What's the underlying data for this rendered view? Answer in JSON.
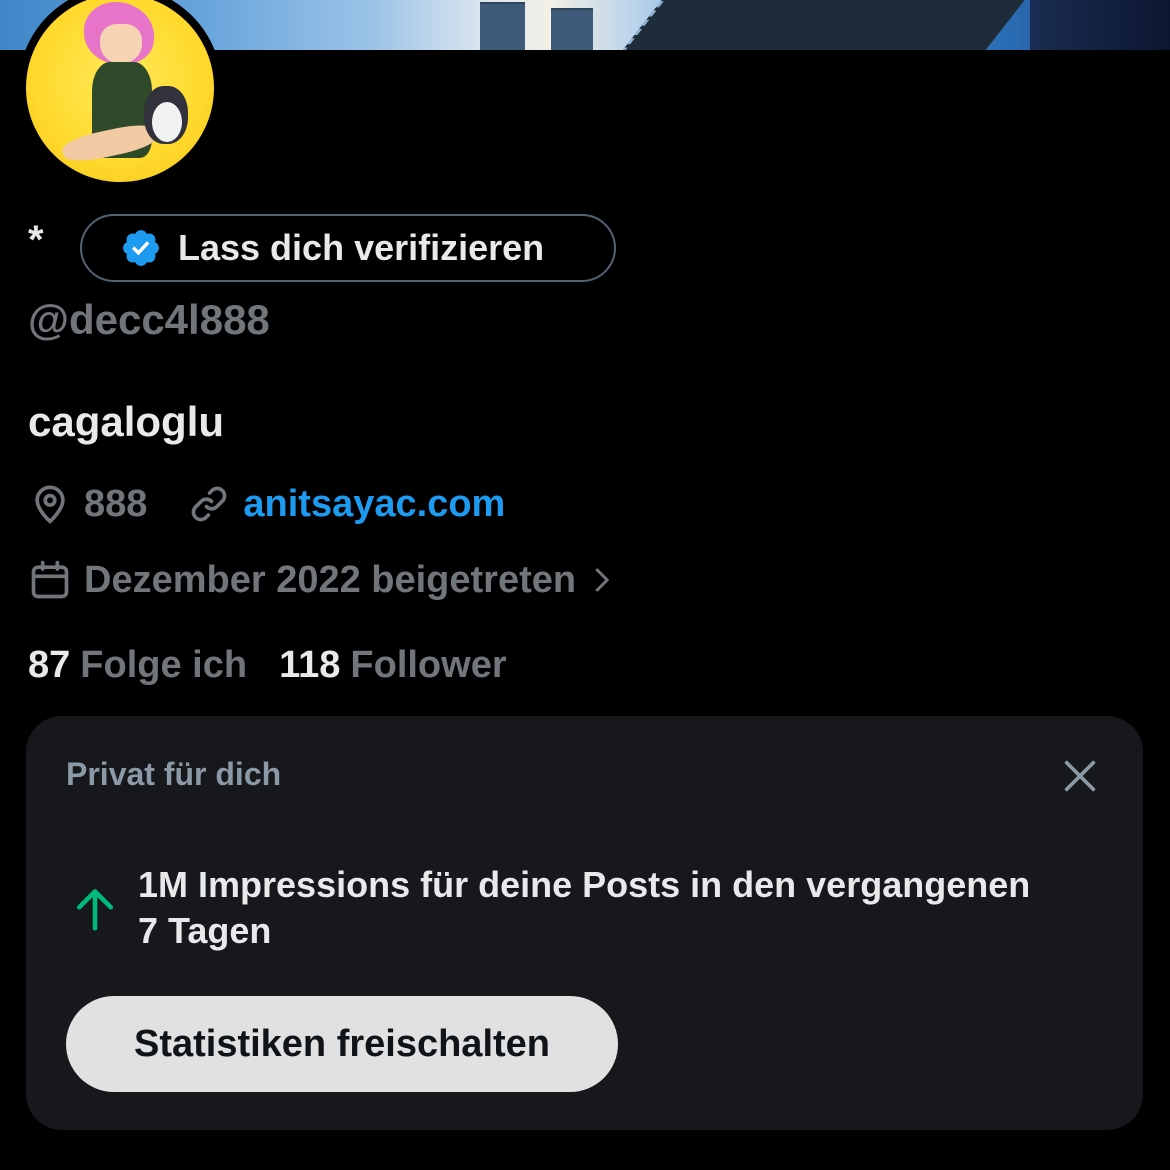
{
  "profile": {
    "display_name": "*",
    "verify_label": "Lass dich verifizieren",
    "handle": "@decc4l888",
    "bio": "cagaloglu",
    "location": "888",
    "website": "anitsayac.com",
    "joined": "Dezember 2022 beigetreten",
    "following_count": "87",
    "following_label": "Folge ich",
    "followers_count": "118",
    "followers_label": "Follower"
  },
  "private_card": {
    "title": "Privat für dich",
    "message": "1M Impressions für deine Posts in den vergangenen 7 Tagen",
    "button_label": "Statistiken freischalten"
  },
  "icons": {
    "verified_badge": "verified-badge-icon",
    "location": "location-pin-icon",
    "link": "link-icon",
    "calendar": "calendar-icon",
    "chevron": "chevron-right-icon",
    "close": "close-icon",
    "trend_up": "arrow-up-icon"
  },
  "colors": {
    "background": "#000000",
    "card_background": "#16181c",
    "primary_text": "#e7e9ea",
    "secondary_text": "#71767b",
    "link": "#1d9bf0",
    "verified_badge": "#1d9bf0",
    "trend_up": "#00ba7c",
    "button_background": "#e1e1e1"
  }
}
